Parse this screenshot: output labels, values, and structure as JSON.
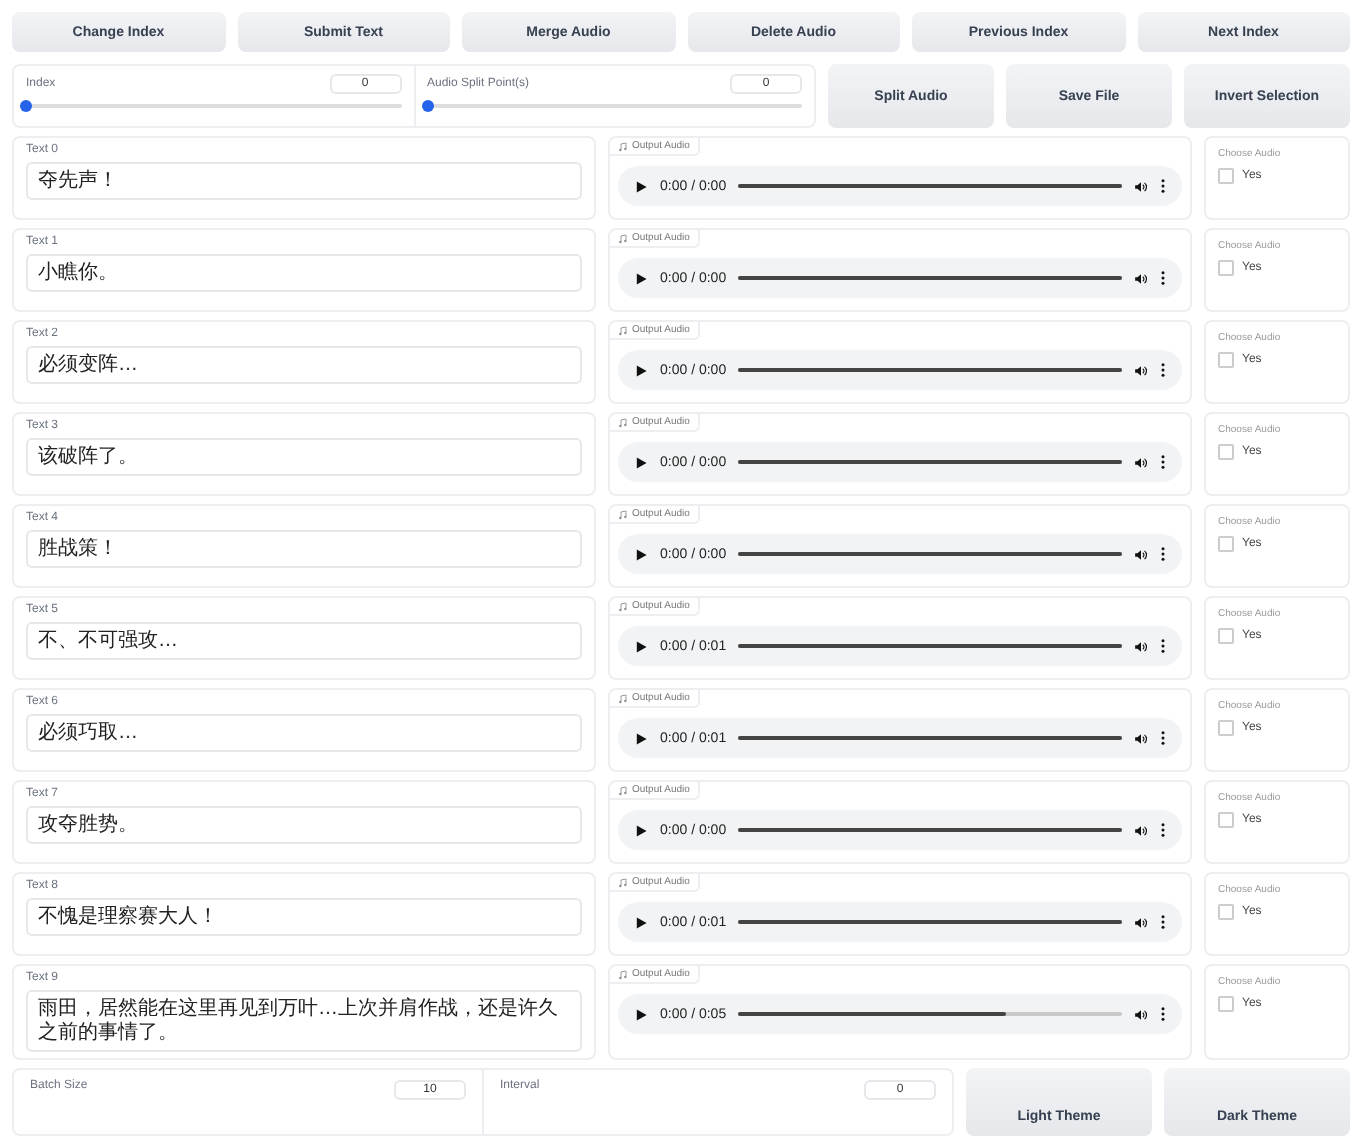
{
  "top_buttons": [
    "Change Index",
    "Submit Text",
    "Merge Audio",
    "Delete Audio",
    "Previous Index",
    "Next Index"
  ],
  "sliders": [
    {
      "label": "Index",
      "value": "0",
      "level": 0
    },
    {
      "label": "Audio Split Point(s)",
      "value": "0",
      "level": 0
    }
  ],
  "action_buttons": [
    "Split Audio",
    "Save File",
    "Invert Selection"
  ],
  "rows": [
    {
      "text_label": "Text 0",
      "text": "夺先声！",
      "audio_label": "Output Audio",
      "time": "0:00 / 0:00",
      "level": 1,
      "choose_label": "Choose Audio",
      "option": "Yes",
      "checked": false
    },
    {
      "text_label": "Text 1",
      "text": "小瞧你。",
      "audio_label": "Output Audio",
      "time": "0:00 / 0:00",
      "level": 1,
      "choose_label": "Choose Audio",
      "option": "Yes",
      "checked": false
    },
    {
      "text_label": "Text 2",
      "text": "必须变阵…",
      "audio_label": "Output Audio",
      "time": "0:00 / 0:00",
      "level": 1,
      "choose_label": "Choose Audio",
      "option": "Yes",
      "checked": false
    },
    {
      "text_label": "Text 3",
      "text": "该破阵了。",
      "audio_label": "Output Audio",
      "time": "0:00 / 0:00",
      "level": 1,
      "choose_label": "Choose Audio",
      "option": "Yes",
      "checked": false
    },
    {
      "text_label": "Text 4",
      "text": "胜战策！",
      "audio_label": "Output Audio",
      "time": "0:00 / 0:00",
      "level": 1,
      "choose_label": "Choose Audio",
      "option": "Yes",
      "checked": false
    },
    {
      "text_label": "Text 5",
      "text": "不、不可强攻…",
      "audio_label": "Output Audio",
      "time": "0:00 / 0:01",
      "level": 1,
      "choose_label": "Choose Audio",
      "option": "Yes",
      "checked": false
    },
    {
      "text_label": "Text 6",
      "text": "必须巧取…",
      "audio_label": "Output Audio",
      "time": "0:00 / 0:01",
      "level": 1,
      "choose_label": "Choose Audio",
      "option": "Yes",
      "checked": false
    },
    {
      "text_label": "Text 7",
      "text": "攻夺胜势。",
      "audio_label": "Output Audio",
      "time": "0:00 / 0:00",
      "level": 1,
      "choose_label": "Choose Audio",
      "option": "Yes",
      "checked": false
    },
    {
      "text_label": "Text 8",
      "text": "不愧是理察赛大人！",
      "audio_label": "Output Audio",
      "time": "0:00 / 0:01",
      "level": 1,
      "choose_label": "Choose Audio",
      "option": "Yes",
      "checked": false
    },
    {
      "text_label": "Text 9",
      "text": "雨田，居然能在这里再见到万叶…上次并肩作战，还是许久之前的事情了。",
      "audio_label": "Output Audio",
      "time": "0:00 / 0:05",
      "level": 0.7,
      "choose_label": "Choose Audio",
      "option": "Yes",
      "checked": false
    }
  ],
  "bottom_fields": [
    {
      "label": "Batch Size",
      "value": "10"
    },
    {
      "label": "Interval",
      "value": "0"
    }
  ],
  "theme_buttons": [
    "Light Theme",
    "Dark Theme"
  ]
}
